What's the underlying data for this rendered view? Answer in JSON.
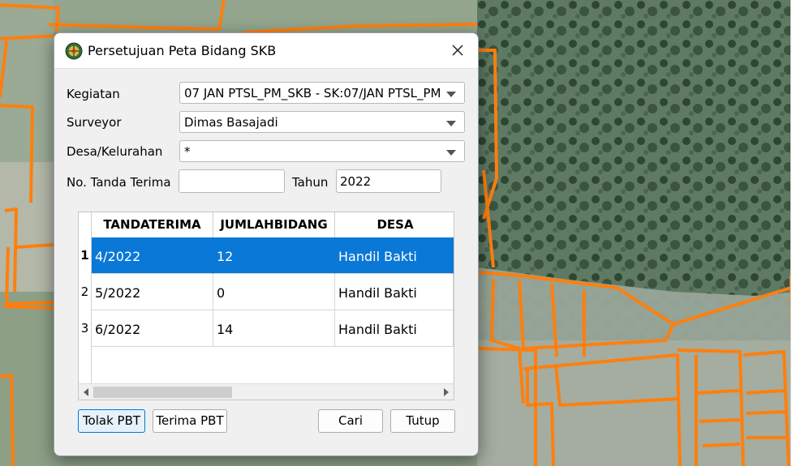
{
  "dialog": {
    "title": "Persetujuan Peta Bidang SKB",
    "icon": "bpn-logo-icon",
    "close_icon": "close-icon"
  },
  "form": {
    "kegiatan_label": "Kegiatan",
    "kegiatan_value": "07 JAN PTSL_PM_SKB - SK:07/JAN PTSL_PM",
    "surveyor_label": "Surveyor",
    "surveyor_value": "Dimas Basajadi",
    "desa_label": "Desa/Kelurahan",
    "desa_value": "*",
    "tanda_label": "No. Tanda Terima",
    "tanda_value": "",
    "tahun_label": "Tahun",
    "tahun_value": "2022"
  },
  "table": {
    "headers": [
      "TANDATERIMA",
      "JUMLAHBIDANG",
      "DESA"
    ],
    "rows": [
      {
        "num": "1",
        "tandaterima": "4/2022",
        "jumlahbidang": "12",
        "desa": "Handil Bakti"
      },
      {
        "num": "2",
        "tandaterima": "5/2022",
        "jumlahbidang": "0",
        "desa": "Handil Bakti"
      },
      {
        "num": "3",
        "tandaterima": "6/2022",
        "jumlahbidang": "14",
        "desa": "Handil Bakti"
      }
    ],
    "selected_row": 1
  },
  "buttons": {
    "tolak": "Tolak PBT",
    "terima": "Terima PBT",
    "cari": "Cari",
    "tutup": "Tutup"
  },
  "colors": {
    "selection": "#0a78d7",
    "parcel_outline": "#ff7f0e",
    "vegetation": "#3f5a45",
    "field": "#8f9f88"
  }
}
